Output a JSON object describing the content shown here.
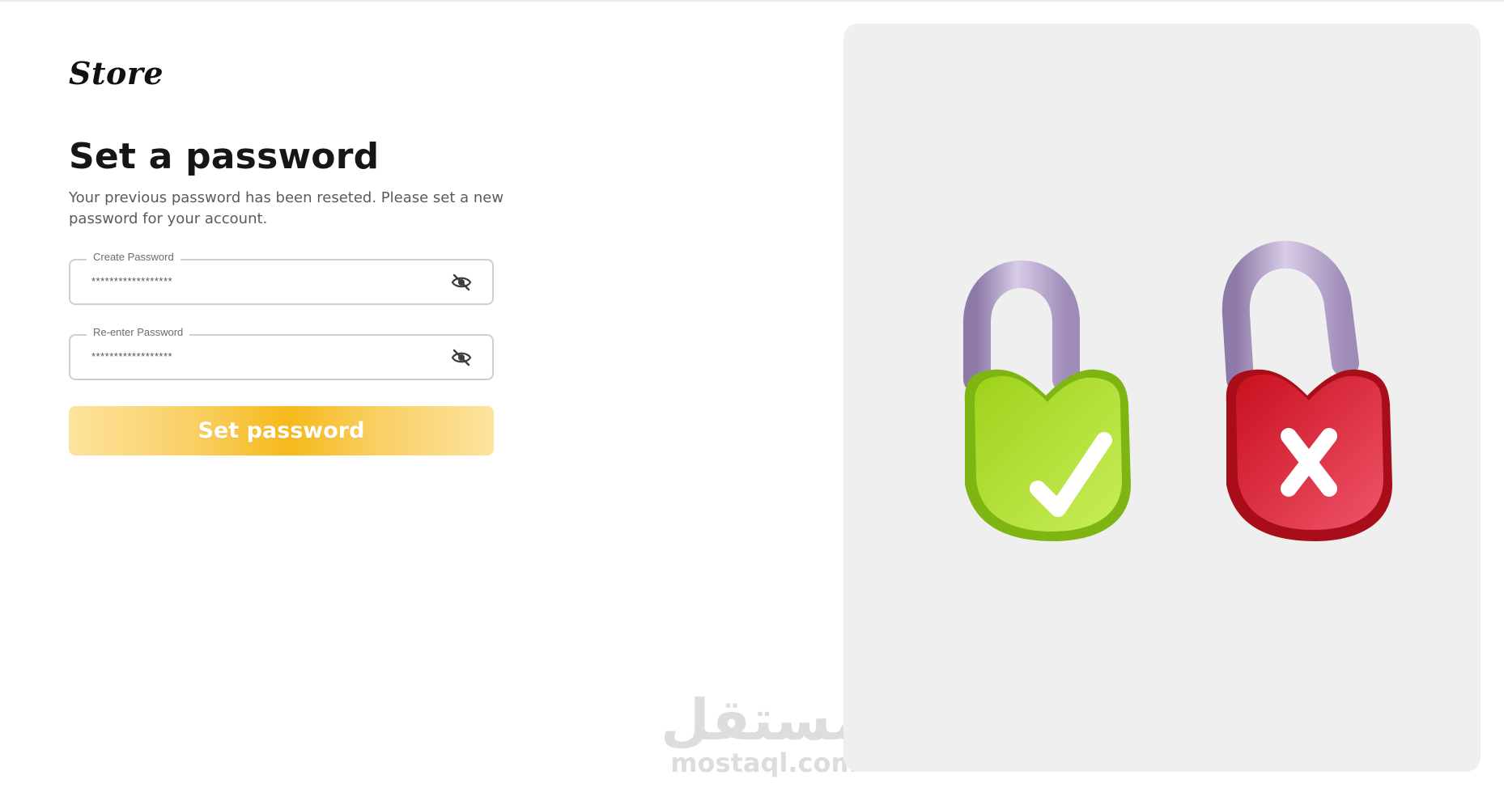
{
  "brand": {
    "name": "Store"
  },
  "form": {
    "title": "Set a password",
    "subtitle": "Your previous password has been reseted. Please set a new password for your account.",
    "fields": [
      {
        "label": "Create Password",
        "value": "******************",
        "icon": "eye-off-icon"
      },
      {
        "label": "Re-enter Password",
        "value": "******************",
        "icon": "eye-off-icon"
      }
    ],
    "submit_label": "Set password"
  },
  "watermark": {
    "arabic": "مستقل",
    "latin": "mostaql.com"
  },
  "illustration": {
    "items": [
      {
        "name": "locked-padlock-check",
        "color": "#a6d81f",
        "mark": "check"
      },
      {
        "name": "open-padlock-cross",
        "color": "#d91f30",
        "mark": "cross"
      }
    ],
    "shackle_color": "#b7a5cc",
    "background": "#efefef"
  },
  "colors": {
    "accent": "#f6b91a",
    "heading": "#161616",
    "muted_text": "#5b5b5b",
    "border": "#cfcfcf"
  }
}
